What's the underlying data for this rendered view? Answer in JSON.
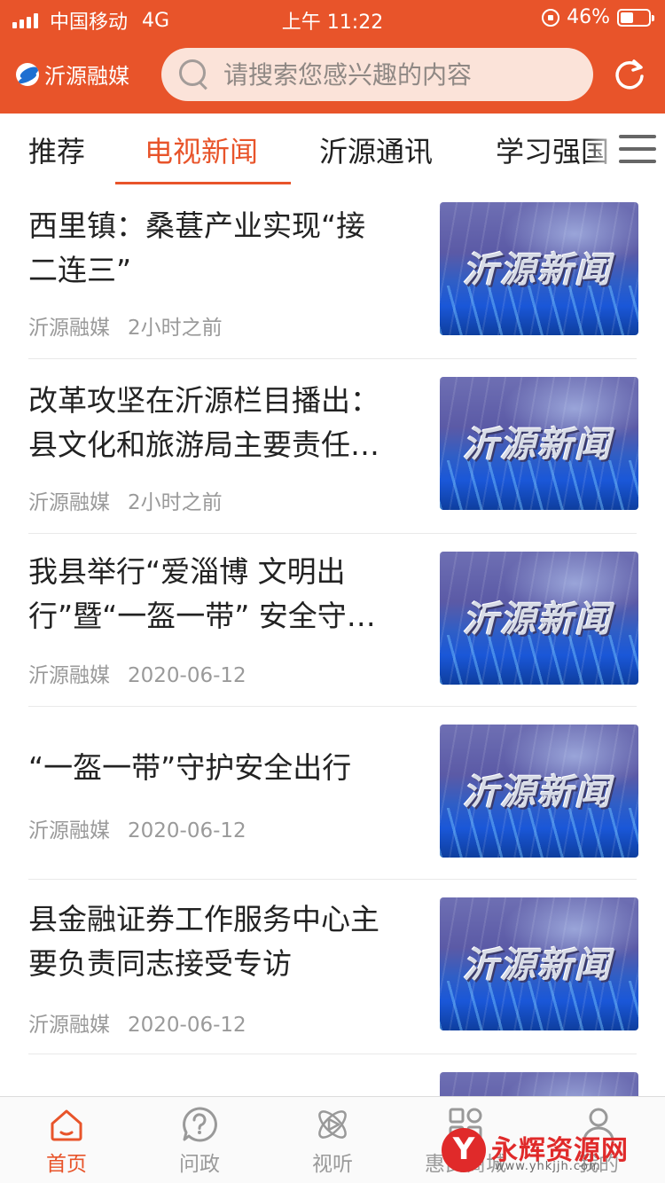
{
  "status_bar": {
    "carrier": "中国移动",
    "network": "4G",
    "time": "上午 11:22",
    "battery_percent": "46%",
    "battery_level": 0.46
  },
  "app": {
    "logo_text": "沂源融媒",
    "search_placeholder": "请搜索您感兴趣的内容",
    "accent_color": "#e8542a",
    "icons": {
      "search": "search-icon",
      "refresh": "refresh-icon",
      "menu": "menu-icon"
    }
  },
  "tabs": [
    {
      "label": "推荐",
      "active": false
    },
    {
      "label": "电视新闻",
      "active": true
    },
    {
      "label": "沂源通讯",
      "active": false
    },
    {
      "label": "学习强国",
      "active": false
    }
  ],
  "feed": [
    {
      "title": "西里镇：桑葚产业实现“接\n二连三”",
      "source": "沂源融媒",
      "time": "2小时之前",
      "thumb_text": "沂源新闻"
    },
    {
      "title": "改革攻坚在沂源栏目播出：\n县文化和旅游局主要责任…",
      "source": "沂源融媒",
      "time": "2小时之前",
      "thumb_text": "沂源新闻"
    },
    {
      "title": "我县举行“爱淄博 文明出\n行”暨“一盔一带” 安全守…",
      "source": "沂源融媒",
      "time": "2020-06-12",
      "thumb_text": "沂源新闻"
    },
    {
      "title": "“一盔一带”守护安全出行",
      "source": "沂源融媒",
      "time": "2020-06-12",
      "thumb_text": "沂源新闻"
    },
    {
      "title": "县金融证券工作服务中心主\n要负责同志接受专访",
      "source": "沂源融媒",
      "time": "2020-06-12",
      "thumb_text": "沂源新闻"
    }
  ],
  "bottom_nav": [
    {
      "label": "首页",
      "icon": "home-icon",
      "active": true
    },
    {
      "label": "问政",
      "icon": "question-icon",
      "active": false
    },
    {
      "label": "视听",
      "icon": "play-atom-icon",
      "active": false
    },
    {
      "label": "惠民商城",
      "icon": "grid-icon",
      "active": false
    },
    {
      "label": "我的",
      "icon": "user-icon",
      "active": false
    }
  ],
  "watermark": {
    "text": "永辉资源网",
    "url": "www.yhkjjh.com"
  }
}
